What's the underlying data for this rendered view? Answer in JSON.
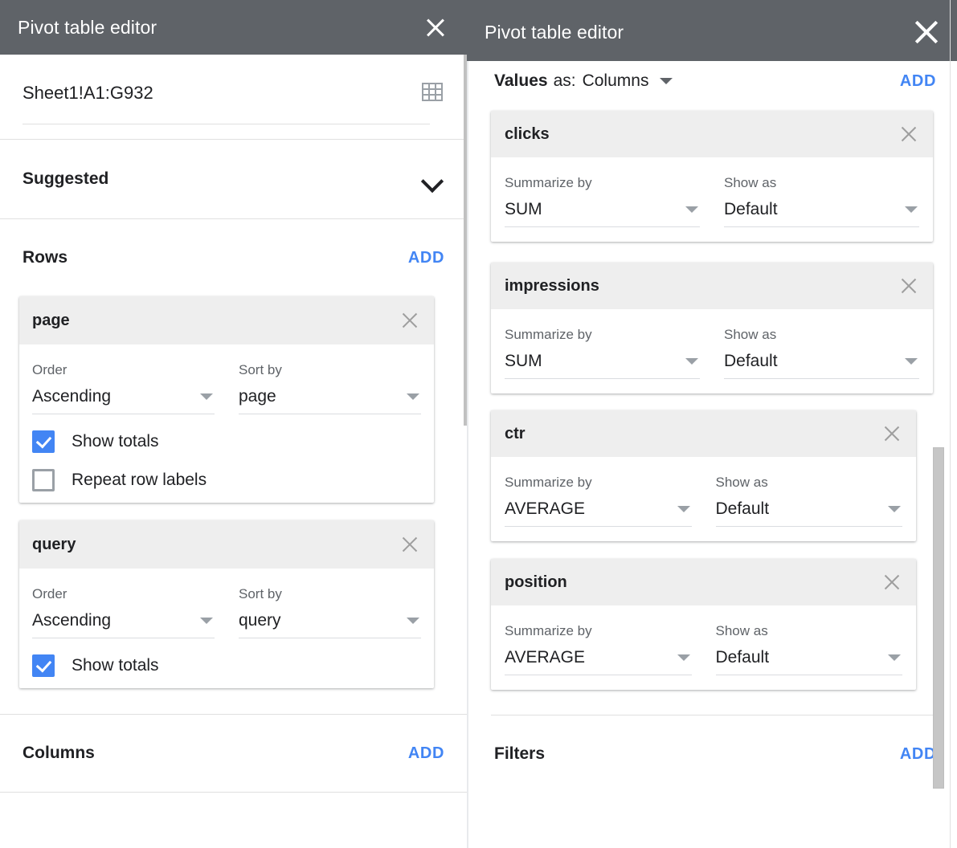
{
  "left_panel": {
    "header": {
      "title": "Pivot table editor",
      "close_icon": "close-icon"
    },
    "data_range": {
      "value": "Sheet1!A1:G932",
      "grid_icon": "select-data-range-grid-icon"
    },
    "suggested": {
      "label": "Suggested",
      "chevron_icon": "chevron-down-icon"
    },
    "rows": {
      "label": "Rows",
      "add_label": "ADD",
      "fields": [
        {
          "name": "page",
          "close_icon": "close-icon",
          "order_label": "Order",
          "order_value": "Ascending",
          "sort_by_label": "Sort by",
          "sort_by_value": "page",
          "checkboxes": [
            {
              "label": "Show totals",
              "checked": true
            },
            {
              "label": "Repeat row labels",
              "checked": false
            }
          ]
        },
        {
          "name": "query",
          "close_icon": "close-icon",
          "order_label": "Order",
          "order_value": "Ascending",
          "sort_by_label": "Sort by",
          "sort_by_value": "query",
          "checkboxes": [
            {
              "label": "Show totals",
              "checked": true
            }
          ]
        }
      ]
    },
    "columns": {
      "label": "Columns",
      "add_label": "ADD"
    }
  },
  "right_panel": {
    "header": {
      "title": "Pivot table editor",
      "close_icon": "close-icon"
    },
    "values": {
      "label": "Values",
      "as_label": "as:",
      "as_value": "Columns",
      "caret_icon": "chevron-down-icon",
      "add_label": "ADD",
      "fields": [
        {
          "name": "clicks",
          "close_icon": "close-icon",
          "summarize_label": "Summarize by",
          "summarize_value": "SUM",
          "show_as_label": "Show as",
          "show_as_value": "Default"
        },
        {
          "name": "impressions",
          "close_icon": "close-icon",
          "summarize_label": "Summarize by",
          "summarize_value": "SUM",
          "show_as_label": "Show as",
          "show_as_value": "Default"
        },
        {
          "name": "ctr",
          "close_icon": "close-icon",
          "summarize_label": "Summarize by",
          "summarize_value": "AVERAGE",
          "show_as_label": "Show as",
          "show_as_value": "Default"
        },
        {
          "name": "position",
          "close_icon": "close-icon",
          "summarize_label": "Summarize by",
          "summarize_value": "AVERAGE",
          "show_as_label": "Show as",
          "show_as_value": "Default"
        }
      ]
    },
    "filters": {
      "label": "Filters",
      "add_label": "ADD"
    }
  },
  "colors": {
    "header_bg": "#5f6368",
    "accent_blue": "#4285f4",
    "card_head_bg": "#eeeeee",
    "text_primary": "#202124",
    "text_secondary": "#5f6368",
    "divider": "#e0e0e0"
  }
}
